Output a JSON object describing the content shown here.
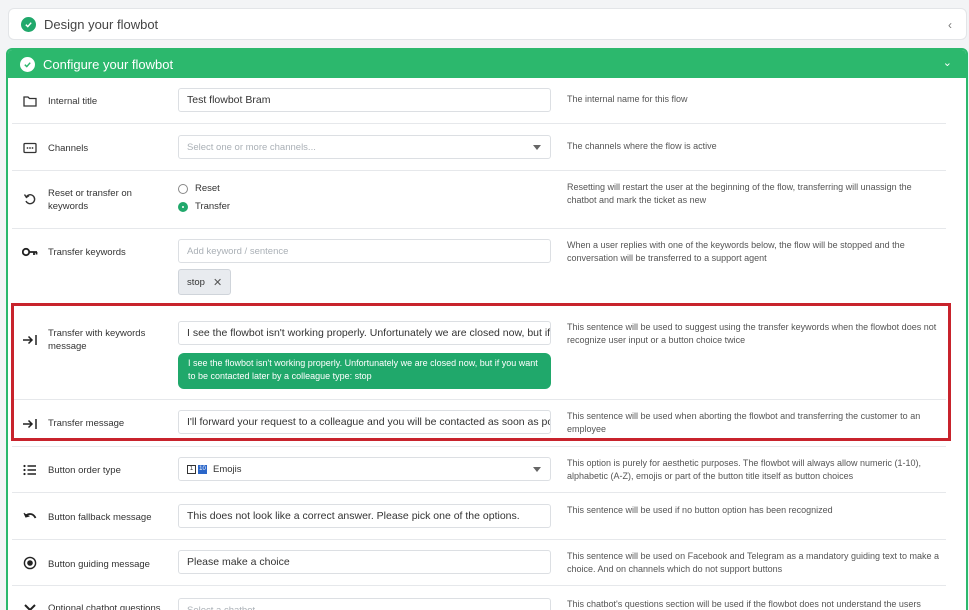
{
  "panels": {
    "design": {
      "title": "Design your flowbot",
      "chevron": "‹"
    },
    "configure": {
      "title": "Configure your flowbot",
      "chevron": "⌄"
    }
  },
  "rows": {
    "internal_title": {
      "label": "Internal title",
      "value": "Test flowbot Bram",
      "desc": "The internal name for this flow",
      "icon": "folder-icon"
    },
    "channels": {
      "label": "Channels",
      "placeholder": "Select one or more channels...",
      "desc": "The channels where the flow is active",
      "icon": "channels-icon"
    },
    "reset_transfer": {
      "label": "Reset or transfer on keywords",
      "options": [
        "Reset",
        "Transfer"
      ],
      "selected": "Transfer",
      "desc": "Resetting will restart the user at the beginning of the flow, transferring will unassign the chatbot and mark the ticket as new",
      "icon": "reset-icon"
    },
    "transfer_keywords": {
      "label": "Transfer keywords",
      "placeholder": "Add keyword / sentence",
      "tag": "stop",
      "tag_remove": "✕",
      "desc": "When a user replies with one of the keywords below, the flow will be stopped and the conversation will be transferred to a support agent",
      "icon": "key-icon"
    },
    "transfer_keywords_message": {
      "label": "Transfer with keywords message",
      "value": "I see the flowbot isn't working properly. Unfortunately we are closed now, but if you want to be contacted later by a colleague type: stop",
      "value_shown": "I see the flowbot isn't working properly. Unfortunately we are closed now, but if yo",
      "preview": "I see the flowbot isn't working properly. Unfortunately we are closed now, but if you want to be contacted later by a colleague type: stop",
      "desc": "This sentence will be used to suggest using the transfer keywords when the flowbot does not recognize user input or a button choice twice",
      "icon": "transfer-icon"
    },
    "transfer_message": {
      "label": "Transfer message",
      "value": "I'll forward your request to a colleague and you will be contacted as soon as possil",
      "desc": "This sentence will be used when aborting the flowbot and transferring the customer to an employee",
      "icon": "transfer-icon"
    },
    "button_order_type": {
      "label": "Button order type",
      "value": "Emojis",
      "desc": "This option is purely for aesthetic purposes. The flowbot will always allow numeric (1-10), alphabetic (A-Z), emojis or part of the button title itself as button choices",
      "icon": "list-icon",
      "emoji_1": "1",
      "emoji_2": "10"
    },
    "button_fallback": {
      "label": "Button fallback message",
      "value": "This does not look like a correct answer. Please pick one of the options.",
      "desc": "This sentence will be used if no button option has been recognized",
      "icon": "undo-icon"
    },
    "button_guiding": {
      "label": "Button guiding message",
      "value": "Please make a choice",
      "desc": "This sentence will be used on Facebook and Telegram as a mandatory guiding text to make a choice. And on channels which do not support buttons",
      "icon": "radio-icon"
    },
    "optional_questions": {
      "label": "Optional chatbot questions",
      "placeholder": "Select a chatbot",
      "desc": "This chatbot's questions section will be used if the flowbot does not understand the users",
      "icon": "chevron-down-icon"
    }
  },
  "colors": {
    "accent": "#2cb86d",
    "highlight": "#c8232c"
  }
}
